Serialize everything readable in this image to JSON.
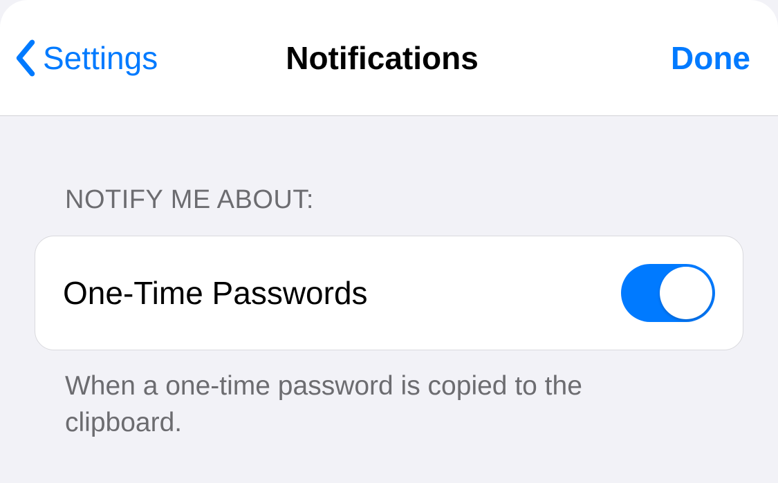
{
  "nav": {
    "back_label": "Settings",
    "title": "Notifications",
    "done_label": "Done"
  },
  "section": {
    "header": "Notify me about:",
    "row_label": "One-Time Passwords",
    "toggle_on": true,
    "footer": "When a one-time password is copied to the clipboard."
  },
  "colors": {
    "accent": "#007aff",
    "background": "#f2f2f7",
    "row_bg": "#ffffff",
    "secondary_text": "#6c6c70"
  }
}
